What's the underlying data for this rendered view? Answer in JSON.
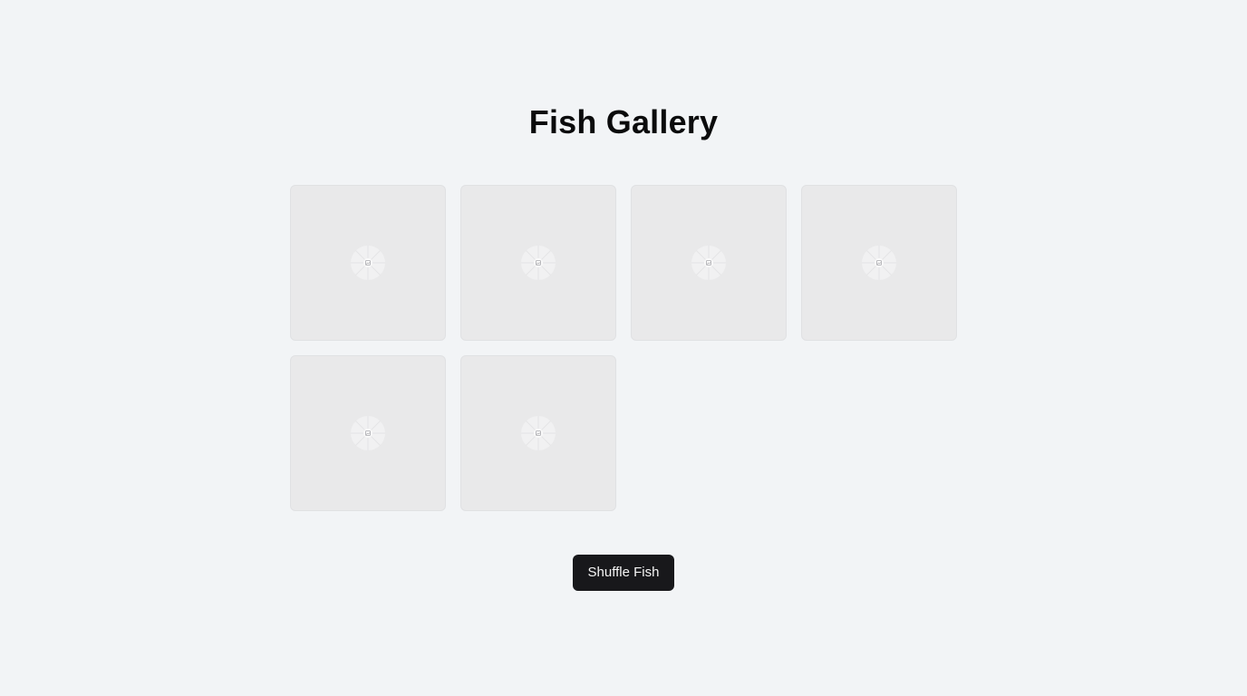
{
  "page": {
    "title": "Fish Gallery"
  },
  "gallery": {
    "items": [
      {
        "state": "loading",
        "icon": "image-placeholder-icon"
      },
      {
        "state": "loading",
        "icon": "image-placeholder-icon"
      },
      {
        "state": "loading",
        "icon": "image-placeholder-icon"
      },
      {
        "state": "loading",
        "icon": "image-placeholder-icon"
      },
      {
        "state": "loading",
        "icon": "image-placeholder-icon"
      },
      {
        "state": "loading",
        "icon": "image-placeholder-icon"
      }
    ]
  },
  "actions": {
    "shuffle_label": "Shuffle Fish"
  },
  "colors": {
    "background": "#f2f4f6",
    "tile": "#e9e9ea",
    "button": "#18181b",
    "button_text": "#f5f5f5",
    "title": "#0b0b0c"
  }
}
